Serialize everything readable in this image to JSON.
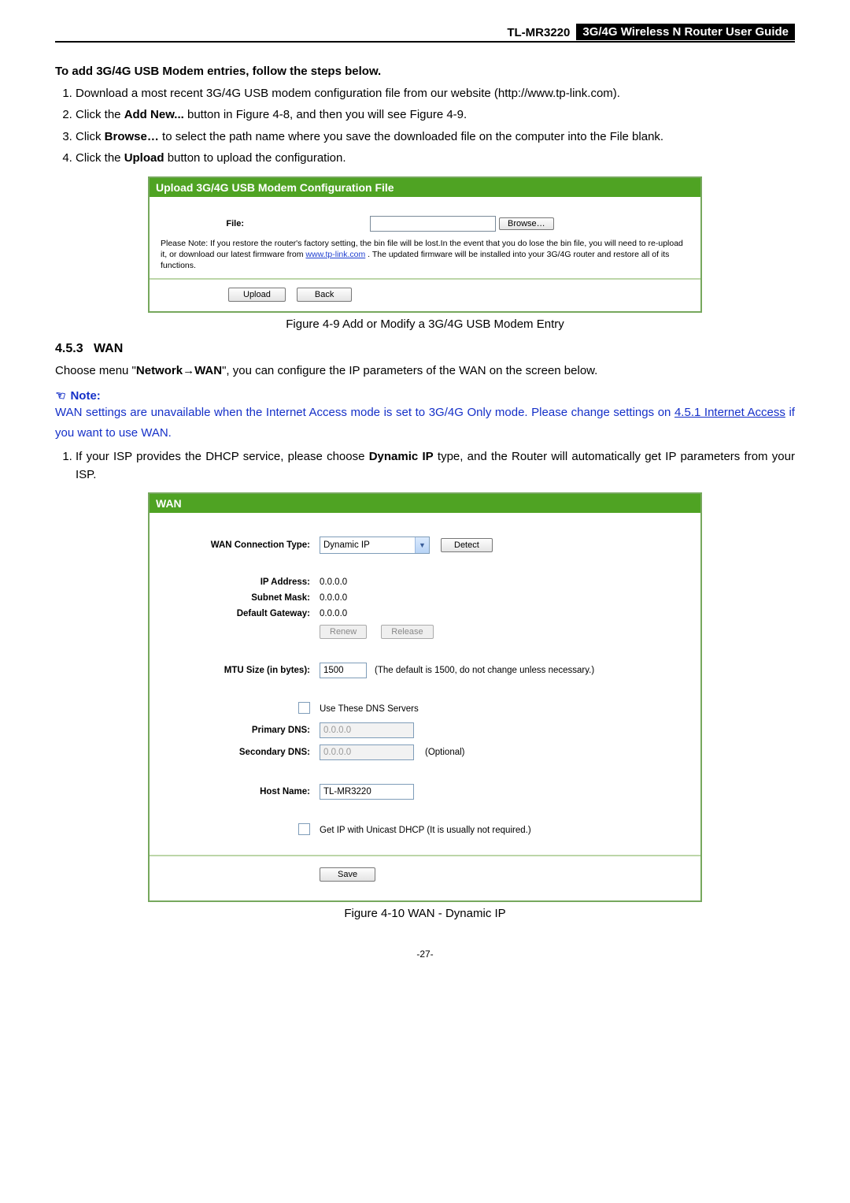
{
  "header": {
    "model": "TL-MR3220",
    "title": "3G/4G Wireless N Router User Guide"
  },
  "section1": {
    "heading": "To add 3G/4G USB Modem entries, follow the steps below.",
    "steps": {
      "s1a": "Download a most recent 3G/4G USB modem configuration file from our website (http://www.tp-link.com).",
      "s2a": "Click the ",
      "s2b": "Add New...",
      "s2c": " button in Figure 4-8, and then you will see Figure 4-9.",
      "s3a": "Click ",
      "s3b": "Browse…",
      "s3c": " to select the path name where you save the downloaded file on the computer into the File blank.",
      "s4a": "Click the ",
      "s4b": "Upload",
      "s4c": " button to upload the configuration."
    }
  },
  "fig1": {
    "title": "Upload 3G/4G USB Modem Configuration File",
    "file_label": "File:",
    "browse": "Browse…",
    "note_a": "Please Note: If you restore the router's factory setting, the bin file will be lost.In the event that you do lose the bin file, you will need to re-upload it, or download our latest firmware from ",
    "note_link": "www.tp-link.com",
    "note_b": " . The updated firmware will be installed into your 3G/4G router and restore all of its functions.",
    "upload": "Upload",
    "back": "Back",
    "caption": "Figure 4-9   Add or Modify a 3G/4G USB Modem Entry"
  },
  "wan_section": {
    "num": "4.5.3",
    "title": "WAN",
    "p1a": "Choose menu \"",
    "p1b": "Network",
    "p1c": "→",
    "p1d": "WAN",
    "p1e": "\", you can configure the IP parameters of the WAN on the screen below.",
    "note_hd": "Note:",
    "note_a": "WAN settings are unavailable when the Internet Access mode is set to 3G/4G Only mode. Please change settings on ",
    "note_link": "4.5.1 Internet Access",
    "note_b": " if you want to use WAN.",
    "li1a": "If your ISP provides the DHCP service, please choose ",
    "li1b": "Dynamic IP",
    "li1c": " type, and the Router will automatically get IP parameters from your ISP."
  },
  "fig2": {
    "title": "WAN",
    "labels": {
      "conn_type": "WAN Connection Type:",
      "ip": "IP Address:",
      "mask": "Subnet Mask:",
      "gw": "Default Gateway:",
      "mtu": "MTU Size (in bytes):",
      "pdns": "Primary DNS:",
      "sdns": "Secondary DNS:",
      "host": "Host Name:"
    },
    "values": {
      "conn_type": "Dynamic IP",
      "detect": "Detect",
      "ip": "0.0.0.0",
      "mask": "0.0.0.0",
      "gw": "0.0.0.0",
      "renew": "Renew",
      "release": "Release",
      "mtu": "1500",
      "mtu_hint": "(The default is 1500, do not change unless necessary.)",
      "use_dns": "Use These DNS Servers",
      "pdns": "0.0.0.0",
      "sdns": "0.0.0.0",
      "optional": "(Optional)",
      "host": "TL-MR3220",
      "unicast": "Get IP with Unicast DHCP (It is usually not required.)",
      "save": "Save"
    },
    "caption": "Figure 4-10 WAN - Dynamic IP"
  },
  "page_num": "-27-"
}
